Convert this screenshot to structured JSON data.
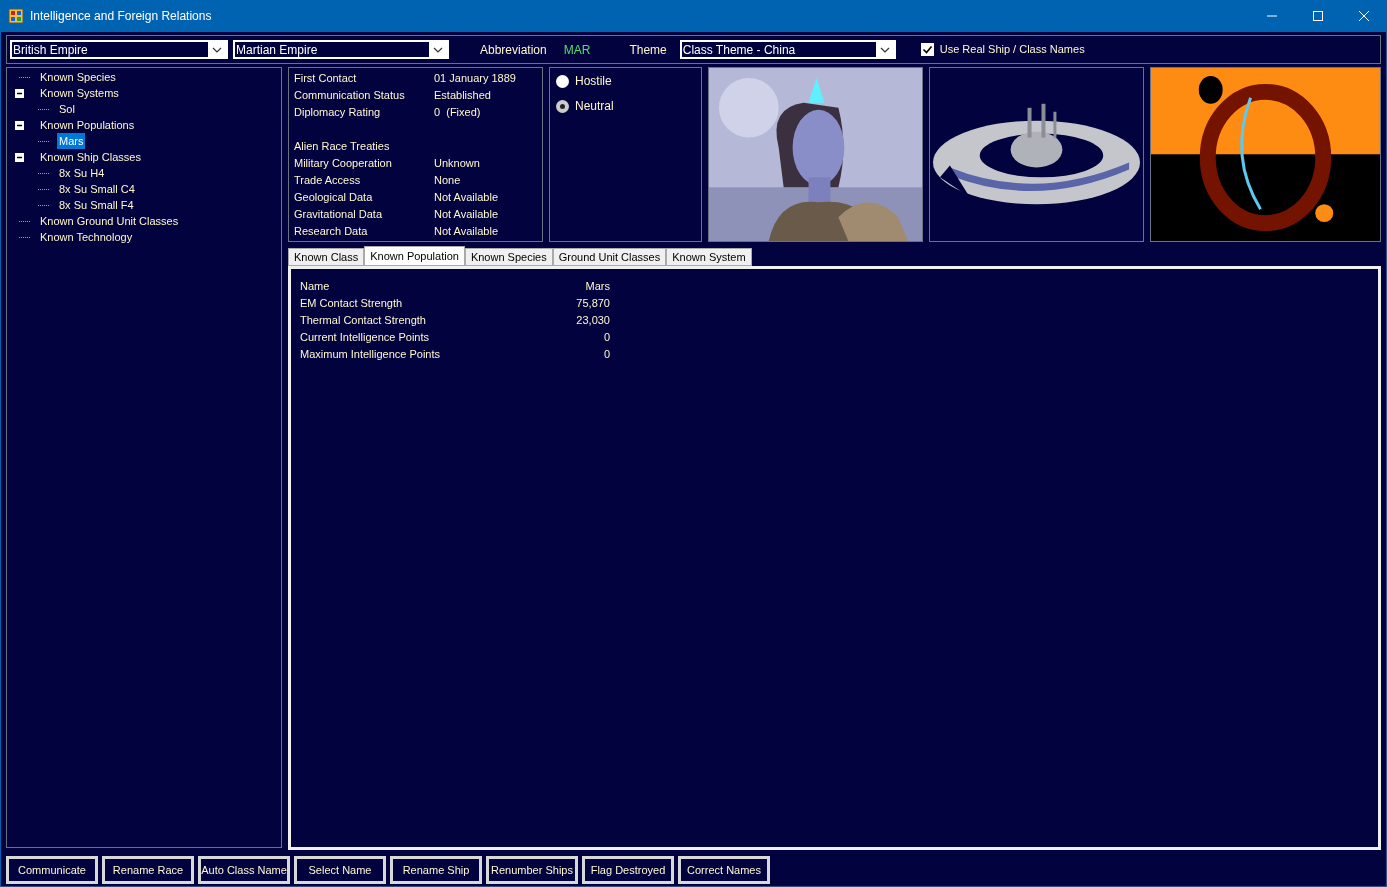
{
  "window": {
    "title": "Intelligence and Foreign Relations"
  },
  "toolbar": {
    "race_select": "British Empire",
    "alien_select": "Martian Empire",
    "abbreviation_label": "Abbreviation",
    "abbreviation": "MAR",
    "theme_label": "Theme",
    "theme_select": "Class Theme - China",
    "real_names": {
      "label": "Use Real Ship / Class Names",
      "checked": true
    }
  },
  "tree": [
    {
      "label": "Known Species",
      "selected": false
    },
    {
      "label": "Known Systems",
      "selected": false,
      "expanded": true,
      "children": [
        {
          "label": "Sol",
          "selected": false
        }
      ]
    },
    {
      "label": "Known Populations",
      "selected": false,
      "expanded": true,
      "children": [
        {
          "label": "Mars",
          "selected": true
        }
      ]
    },
    {
      "label": "Known Ship Classes",
      "selected": false,
      "expanded": true,
      "children": [
        {
          "label": "8x Su H4",
          "selected": false
        },
        {
          "label": "8x Su Small C4",
          "selected": false
        },
        {
          "label": "8x Su Small F4",
          "selected": false
        }
      ]
    },
    {
      "label": "Known Ground Unit Classes",
      "selected": false
    },
    {
      "label": "Known Technology",
      "selected": false
    }
  ],
  "info": [
    {
      "kind": "row",
      "label": "First Contact",
      "value": "01 January 1889"
    },
    {
      "kind": "row",
      "label": "Communication Status",
      "value": "Established"
    },
    {
      "kind": "row",
      "label": "Diplomacy Rating",
      "value": "0  (Fixed)"
    },
    {
      "kind": "heading",
      "label": "Alien Race Treaties"
    },
    {
      "kind": "row",
      "label": "Military Cooperation",
      "value": "Unknown"
    },
    {
      "kind": "row",
      "label": "Trade Access",
      "value": "None"
    },
    {
      "kind": "row",
      "label": "Geological Data",
      "value": "Not Available"
    },
    {
      "kind": "row",
      "label": "Gravitational Data",
      "value": "Not Available"
    },
    {
      "kind": "row",
      "label": "Research Data",
      "value": "Not Available"
    }
  ],
  "stance": [
    {
      "label": "Hostile",
      "selected": false
    },
    {
      "label": "Neutral",
      "selected": true
    }
  ],
  "images": [
    {
      "kind": "picture"
    },
    {
      "kind": "picture"
    }
  ],
  "tabs": [
    {
      "label": "Known Class",
      "selected": false
    },
    {
      "label": "Known Population",
      "selected": true
    },
    {
      "label": "Known Species",
      "selected": false
    },
    {
      "label": "Ground Unit Classes",
      "selected": false
    },
    {
      "label": "Known System",
      "selected": false
    }
  ],
  "population": [
    {
      "label": "Name",
      "value": "Mars"
    },
    {
      "label": "EM Contact Strength",
      "value": "75,870"
    },
    {
      "label": "Thermal Contact Strength",
      "value": "23,030"
    },
    {
      "label": "Current Intelligence Points",
      "value": "0"
    },
    {
      "label": "Maximum Intelligence Points",
      "value": "0"
    }
  ],
  "buttons": [
    "Communicate",
    "Rename Race",
    "Auto Class Name",
    "Select Name",
    "Rename Ship",
    "Renumber Ships",
    "Flag Destroyed",
    "Correct Names"
  ]
}
